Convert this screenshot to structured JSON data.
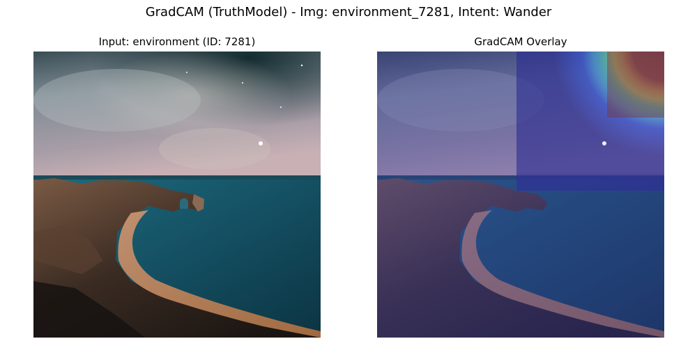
{
  "figure": {
    "title": "GradCAM (TruthModel) - Img: environment_7281, Intent: Wander"
  },
  "panels": [
    {
      "title": "Input: environment (ID: 7281)",
      "content": "night sky over sea arch and curved beach"
    },
    {
      "title": "GradCAM Overlay",
      "content": "same scene with GradCAM heatmap overlay, activation concentrated in upper-right sky"
    }
  ],
  "colors": {
    "sky_dark": "#1f3a3e",
    "sky_light": "#b8b8c2",
    "horizon_pink": "#c6aab0",
    "sea": "#13495a",
    "beach": "#b0805a",
    "cliff": "#6a4a36",
    "overlay_base": "#3a3fa0",
    "heat_red": "#7a3a3a",
    "heat_blue": "#3c50d8"
  }
}
